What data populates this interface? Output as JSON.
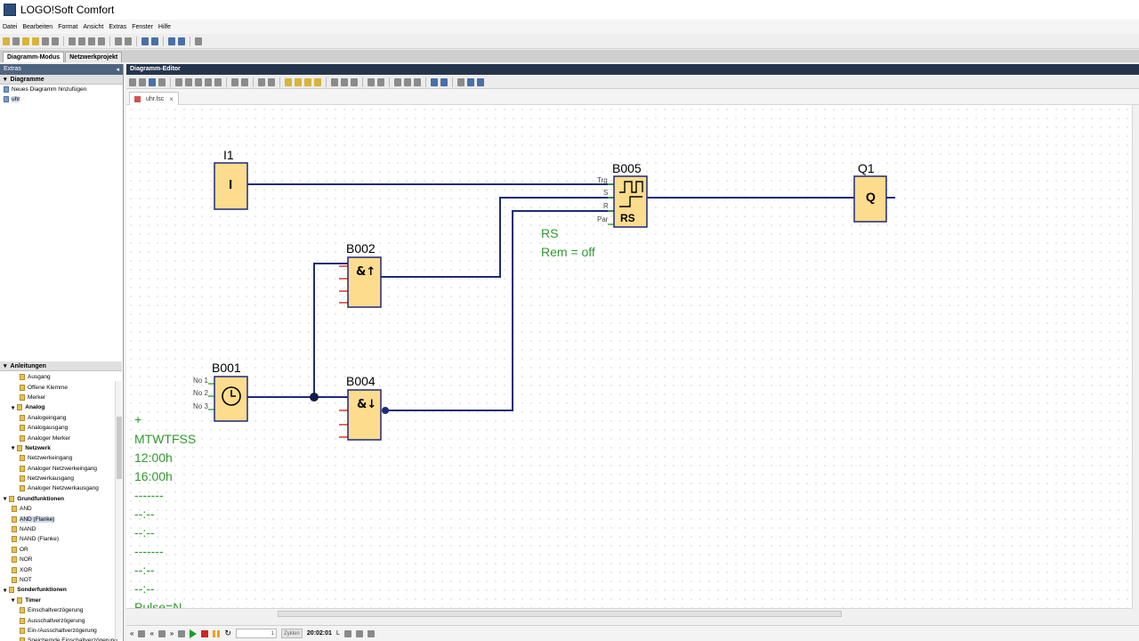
{
  "window": {
    "title": "LOGO!Soft Comfort"
  },
  "menu": [
    "Datei",
    "Bearbeiten",
    "Format",
    "Ansicht",
    "Extras",
    "Fenster",
    "Hilfe"
  ],
  "mode_tabs": [
    {
      "label": "Diagramm-Modus",
      "active": true
    },
    {
      "label": "Netzwerkprojekt",
      "active": false
    }
  ],
  "left_panel": {
    "header": "Extras",
    "diagrams_section": "Diagramme",
    "add_diagram": "Neues Diagramm hinzufügen",
    "current_file": "uhr",
    "instructions_section": "Anleitungen",
    "tree": [
      {
        "label": "Ausgang",
        "level": 2
      },
      {
        "label": "Offene Klemme",
        "level": 2
      },
      {
        "label": "Merker",
        "level": 2
      },
      {
        "label": "Analog",
        "level": 1,
        "category": true
      },
      {
        "label": "Analogeingang",
        "level": 2
      },
      {
        "label": "Analogausgang",
        "level": 2
      },
      {
        "label": "Analoger Merker",
        "level": 2
      },
      {
        "label": "Netzwerk",
        "level": 1,
        "category": true
      },
      {
        "label": "Netzwerkeingang",
        "level": 2
      },
      {
        "label": "Analoger Netzwerkeingang",
        "level": 2
      },
      {
        "label": "Netzwerkausgang",
        "level": 2
      },
      {
        "label": "Analoger Netzwerkausgang",
        "level": 2
      },
      {
        "label": "Grundfunktionen",
        "level": 0,
        "category": true
      },
      {
        "label": "AND",
        "level": 1
      },
      {
        "label": "AND (Flanke)",
        "level": 1,
        "selected": true
      },
      {
        "label": "NAND",
        "level": 1
      },
      {
        "label": "NAND (Flanke)",
        "level": 1
      },
      {
        "label": "OR",
        "level": 1
      },
      {
        "label": "NOR",
        "level": 1
      },
      {
        "label": "XOR",
        "level": 1
      },
      {
        "label": "NOT",
        "level": 1
      },
      {
        "label": "Sonderfunktionen",
        "level": 0,
        "category": true
      },
      {
        "label": "Timer",
        "level": 1,
        "category": true
      },
      {
        "label": "Einschaltverzögerung",
        "level": 2
      },
      {
        "label": "Ausschaltverzögerung",
        "level": 2
      },
      {
        "label": "Ein-/Ausschaltverzögerung",
        "level": 2
      },
      {
        "label": "Speichernde Einschaltverzögerung",
        "level": 2
      }
    ]
  },
  "editor": {
    "header": "Diagramm-Editor",
    "tab_file": "uhr.lsc"
  },
  "diagram": {
    "blocks": {
      "I1": {
        "name": "I1",
        "symbol": "I"
      },
      "B002": {
        "name": "B002",
        "symbol": "&↑"
      },
      "B001": {
        "name": "B001"
      },
      "B004": {
        "name": "B004",
        "symbol": "&↓"
      },
      "B005": {
        "name": "B005",
        "symbol": "RS"
      },
      "Q1": {
        "name": "Q1",
        "symbol": "Q"
      }
    },
    "b001_pins": [
      "No 1",
      "No 2",
      "No 3"
    ],
    "b005_pins": [
      "Trg",
      "S",
      "R",
      "Par"
    ],
    "b005_params": [
      "RS",
      "Rem = off"
    ],
    "b001_params": [
      "+",
      "MTWTFSS",
      "12:00h",
      "16:00h",
      "-------",
      "--:--",
      "--:--",
      "-------",
      "--:--",
      "--:--",
      "Pulse=N"
    ],
    "colors": {
      "block_fill": "#fddc8d",
      "block_border": "#1f2a7a",
      "wire": "#1f2a7a",
      "param": "#2f9a2f",
      "pin": "#cc3b3b"
    }
  },
  "simulation": {
    "cycles_value": "1",
    "cycles_label": "Zyklen",
    "time": "20:02:01",
    "time_mode": "L"
  }
}
